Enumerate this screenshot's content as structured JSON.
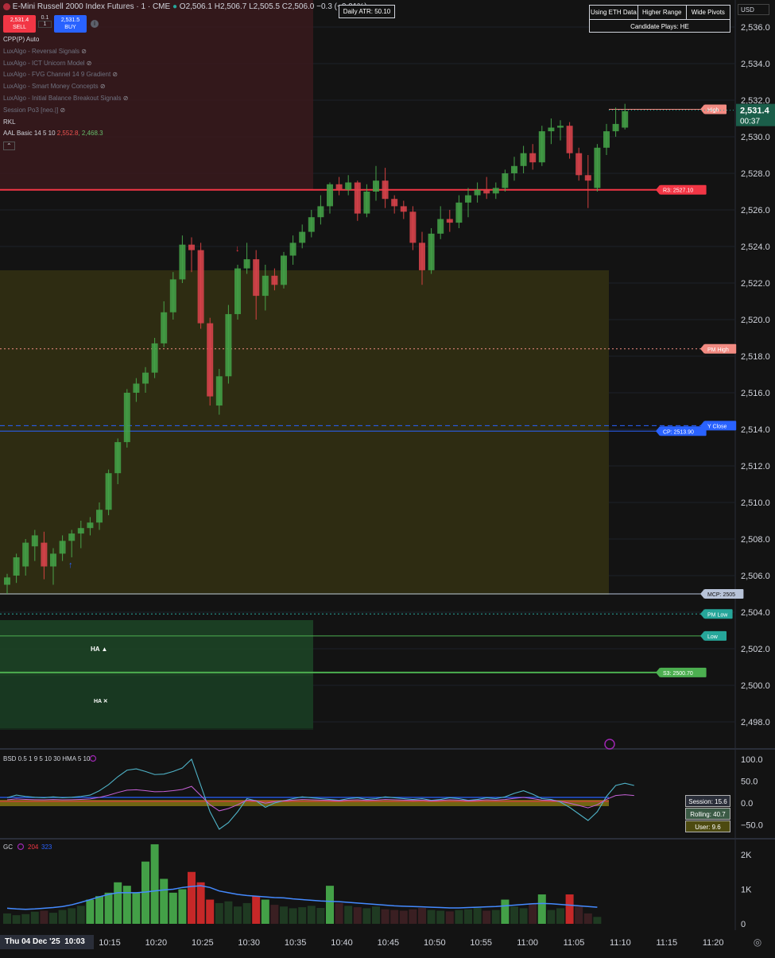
{
  "header": {
    "symbol": "E-Mini Russell 2000 Index Futures · 1 · CME",
    "ohlc": "O2,506.1 H2,506.7 L2,505.5 C2,506.0 −0.3 (−0.01%)",
    "sell_price": "2,531.4",
    "sell_label": "SELL",
    "buy_price": "2,531.5",
    "buy_label": "BUY",
    "qty_step": "0.1",
    "qty": "1",
    "currency": "USD"
  },
  "legend": [
    {
      "text": "CPP(P) Auto",
      "dim": false
    },
    {
      "text": "LuxAlgo - Reversal Signals",
      "dim": true
    },
    {
      "text": "LuxAlgo - ICT Unicorn Model",
      "dim": true
    },
    {
      "text": "LuxAlgo - FVG Channel 14 9 Gradient",
      "dim": true
    },
    {
      "text": "LuxAlgo - Smart Money Concepts",
      "dim": true
    },
    {
      "text": "LuxAlgo - Initial Balance Breakout Signals",
      "dim": true
    },
    {
      "text": "Session Po3 [neo.|]",
      "dim": true
    },
    {
      "text": "RKL",
      "dim": false
    },
    {
      "text": "AAL Basic 14 5 10",
      "dim": false
    }
  ],
  "aal_values": {
    "red": "2,552.8",
    "green": "2,468.3"
  },
  "info": {
    "atr": "Daily ATR: 50.10",
    "opt1": "Using ETH Data",
    "opt2": "Higher Range",
    "opt3": "Wide Pivots",
    "plays": "Candidate Plays: HE"
  },
  "price_axis": [
    "2,536.0",
    "2,534.0",
    "2,532.0",
    "2,530.0",
    "2,528.0",
    "2,526.0",
    "2,524.0",
    "2,522.0",
    "2,520.0",
    "2,518.0",
    "2,516.0",
    "2,514.0",
    "2,512.0",
    "2,510.0",
    "2,508.0",
    "2,506.0",
    "2,504.0",
    "2,502.0",
    "2,500.0",
    "2,498.0"
  ],
  "current": {
    "price": "2,531.4",
    "countdown": "00:37"
  },
  "levels": [
    {
      "label": "High",
      "price": 2531.5,
      "color": "#f28b82"
    },
    {
      "label": "R3: 2527.10",
      "price": 2527.1,
      "color": "#f23645"
    },
    {
      "label": "PM High",
      "price": 2518.4,
      "color": "#f28b82"
    },
    {
      "label": "Y Close",
      "price": 2514.2,
      "color": "#2962ff"
    },
    {
      "label": "CP: 2513.90",
      "price": 2513.9,
      "color": "#2962ff"
    },
    {
      "label": "MCP: 2505",
      "price": 2505.0,
      "color": "#b7c3d8"
    },
    {
      "label": "PM Low",
      "price": 2503.9,
      "color": "#26a69a"
    },
    {
      "label": "Low",
      "price": 2502.7,
      "color": "#26a69a"
    },
    {
      "label": "S3: 2500.70",
      "price": 2500.7,
      "color": "#4caf50"
    }
  ],
  "markers": {
    "ha1": "HA ▲",
    "ha2": "HA ✕"
  },
  "bsd": {
    "title": "BSD 0.5 1 9 5 10 30 HMA 5 10",
    "axis": [
      "100.0",
      "50.0",
      "0.0",
      "−50.0"
    ],
    "session": "Session: 15.6",
    "rolling": "Rolling: 40.7",
    "user": "User: 9.6",
    "line": [
      12,
      18,
      15,
      13,
      12,
      14,
      12,
      13,
      15,
      18,
      28,
      42,
      60,
      75,
      78,
      72,
      65,
      66,
      72,
      80,
      100,
      40,
      -20,
      -60,
      -45,
      -20,
      10,
      5,
      -10,
      0,
      5,
      10,
      14,
      12,
      10,
      8,
      6,
      10,
      12,
      8,
      10,
      14,
      12,
      10,
      8,
      10,
      6,
      8,
      12,
      10,
      6,
      8,
      12,
      10,
      14,
      22,
      28,
      20,
      10,
      8,
      2,
      -10,
      -25,
      -40,
      -20,
      15,
      40,
      45,
      40
    ]
  },
  "gc": {
    "title": "GC",
    "v1": "204",
    "v2": "323",
    "axis": [
      "2K",
      "1K",
      "0"
    ],
    "volumes": [
      300,
      250,
      280,
      350,
      380,
      320,
      400,
      450,
      520,
      700,
      800,
      900,
      1200,
      1100,
      900,
      1800,
      2300,
      1300,
      900,
      1000,
      1500,
      1200,
      700,
      600,
      650,
      500,
      600,
      800,
      700,
      550,
      500,
      450,
      480,
      520,
      460,
      1100,
      600,
      520,
      480,
      450,
      500,
      420,
      400,
      380,
      420,
      460,
      400,
      380,
      360,
      400,
      420,
      460,
      380,
      400,
      700,
      500,
      450,
      600,
      850,
      400,
      450,
      850,
      500,
      300,
      200
    ],
    "avg": [
      450,
      430,
      420,
      430,
      450,
      470,
      500,
      550,
      620,
      700,
      780,
      850,
      900,
      900,
      900,
      920,
      950,
      980,
      1000,
      1050,
      1080,
      1100,
      1050,
      950,
      900,
      850,
      820,
      800,
      780,
      760,
      750,
      720,
      700,
      680,
      660,
      650,
      640,
      620,
      600,
      580,
      560,
      540,
      520,
      510,
      500,
      490,
      480,
      470,
      460,
      460,
      470,
      480,
      490,
      500,
      520,
      540,
      560,
      580,
      590,
      580,
      560,
      540,
      520,
      500,
      480
    ]
  },
  "time_axis": {
    "date": "Thu 04 Dec '25",
    "time": "10:03",
    "ticks": [
      "10:15",
      "10:20",
      "10:25",
      "10:30",
      "10:35",
      "10:40",
      "10:45",
      "10:50",
      "10:55",
      "11:00",
      "11:05",
      "11:10",
      "11:15",
      "11:20"
    ]
  },
  "chart_data": {
    "type": "candlestick",
    "title": "E-Mini Russell 2000 Index Futures · 1 · CME",
    "ylim": [
      2497,
      2537
    ],
    "candles": [
      [
        2505.5,
        2506.1,
        2505.0,
        2505.9
      ],
      [
        2506.0,
        2507.2,
        2505.6,
        2507.0
      ],
      [
        2506.5,
        2508.0,
        2506.0,
        2507.8
      ],
      [
        2507.6,
        2508.5,
        2506.8,
        2508.2
      ],
      [
        2507.8,
        2508.4,
        2505.8,
        2506.5
      ],
      [
        2506.5,
        2507.5,
        2505.5,
        2507.2
      ],
      [
        2507.2,
        2508.2,
        2506.8,
        2507.9
      ],
      [
        2507.9,
        2508.5,
        2507.0,
        2508.3
      ],
      [
        2508.3,
        2509.0,
        2507.5,
        2508.6
      ],
      [
        2508.6,
        2509.2,
        2508.2,
        2508.9
      ],
      [
        2508.9,
        2510.0,
        2508.5,
        2509.6
      ],
      [
        2509.6,
        2511.8,
        2509.3,
        2511.6
      ],
      [
        2511.6,
        2513.5,
        2511.0,
        2513.3
      ],
      [
        2513.3,
        2516.2,
        2513.0,
        2516.0
      ],
      [
        2516.0,
        2516.8,
        2515.5,
        2516.5
      ],
      [
        2516.5,
        2517.4,
        2516.0,
        2517.1
      ],
      [
        2517.1,
        2519.0,
        2516.8,
        2518.7
      ],
      [
        2518.7,
        2521.0,
        2518.5,
        2520.4
      ],
      [
        2520.4,
        2522.6,
        2520.0,
        2522.2
      ],
      [
        2522.2,
        2524.6,
        2522.0,
        2524.1
      ],
      [
        2524.1,
        2524.5,
        2522.6,
        2523.8
      ],
      [
        2523.8,
        2524.2,
        2519.5,
        2519.8
      ],
      [
        2519.8,
        2520.1,
        2515.3,
        2515.8
      ],
      [
        2515.3,
        2517.3,
        2514.8,
        2516.9
      ],
      [
        2516.9,
        2520.8,
        2516.5,
        2520.3
      ],
      [
        2520.3,
        2523.0,
        2520.0,
        2522.8
      ],
      [
        2522.8,
        2524.2,
        2522.5,
        2523.3
      ],
      [
        2523.3,
        2523.8,
        2520.0,
        2521.3
      ],
      [
        2521.3,
        2523.0,
        2520.5,
        2522.4
      ],
      [
        2522.4,
        2522.8,
        2521.6,
        2521.9
      ],
      [
        2521.9,
        2523.7,
        2521.7,
        2523.5
      ],
      [
        2523.5,
        2524.6,
        2523.0,
        2524.2
      ],
      [
        2524.2,
        2525.2,
        2523.9,
        2524.8
      ],
      [
        2524.8,
        2526.0,
        2524.5,
        2525.6
      ],
      [
        2525.6,
        2526.8,
        2525.2,
        2526.2
      ],
      [
        2526.2,
        2527.5,
        2525.8,
        2527.4
      ],
      [
        2527.4,
        2527.8,
        2526.8,
        2527.1
      ],
      [
        2527.1,
        2527.9,
        2526.8,
        2527.5
      ],
      [
        2527.5,
        2527.6,
        2525.4,
        2525.8
      ],
      [
        2525.8,
        2527.4,
        2525.6,
        2527.0
      ],
      [
        2527.0,
        2528.4,
        2526.5,
        2527.6
      ],
      [
        2527.6,
        2528.3,
        2526.1,
        2526.6
      ],
      [
        2526.6,
        2526.8,
        2525.8,
        2526.2
      ],
      [
        2526.2,
        2526.5,
        2525.5,
        2525.9
      ],
      [
        2525.9,
        2526.2,
        2523.8,
        2524.2
      ],
      [
        2524.2,
        2524.8,
        2521.9,
        2522.7
      ],
      [
        2522.7,
        2525.0,
        2522.5,
        2524.7
      ],
      [
        2524.7,
        2526.2,
        2524.4,
        2525.5
      ],
      [
        2525.5,
        2526.0,
        2524.8,
        2525.3
      ],
      [
        2525.3,
        2526.8,
        2525.0,
        2526.4
      ],
      [
        2526.4,
        2527.2,
        2525.6,
        2526.8
      ],
      [
        2526.8,
        2527.5,
        2526.4,
        2527.1
      ],
      [
        2527.1,
        2527.8,
        2526.6,
        2526.9
      ],
      [
        2526.9,
        2527.5,
        2526.6,
        2527.2
      ],
      [
        2527.2,
        2528.2,
        2527.0,
        2528.0
      ],
      [
        2528.0,
        2528.9,
        2527.6,
        2528.4
      ],
      [
        2528.4,
        2529.5,
        2528.0,
        2529.1
      ],
      [
        2529.1,
        2529.6,
        2528.2,
        2528.6
      ],
      [
        2528.6,
        2530.6,
        2528.4,
        2530.3
      ],
      [
        2530.3,
        2531.0,
        2529.6,
        2530.5
      ],
      [
        2530.5,
        2530.9,
        2529.8,
        2530.6
      ],
      [
        2530.6,
        2530.8,
        2528.8,
        2529.1
      ],
      [
        2529.1,
        2529.4,
        2527.6,
        2527.9
      ],
      [
        2527.9,
        2529.0,
        2526.1,
        2527.6
      ],
      [
        2527.2,
        2529.6,
        2527.0,
        2529.4
      ],
      [
        2529.4,
        2530.7,
        2529.0,
        2530.3
      ],
      [
        2530.3,
        2531.6,
        2530.0,
        2530.7
      ],
      [
        2530.5,
        2531.8,
        2530.4,
        2531.4
      ]
    ],
    "annotations": [
      "HA ▲",
      "HA ✕"
    ]
  }
}
